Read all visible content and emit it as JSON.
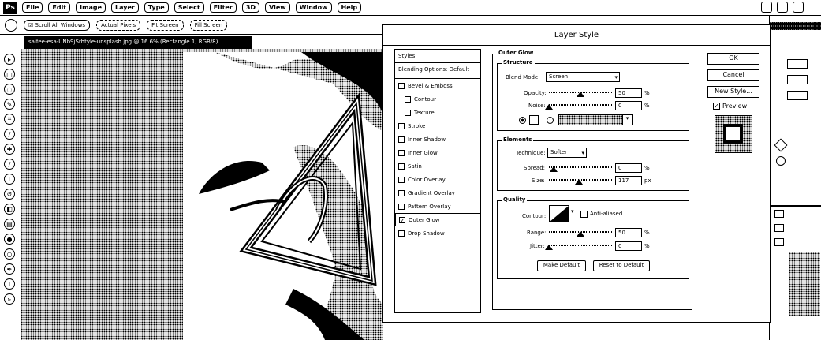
{
  "app": {
    "logo": "Ps",
    "menu": [
      "File",
      "Edit",
      "Image",
      "Layer",
      "Type",
      "Select",
      "Filter",
      "3D",
      "View",
      "Window",
      "Help"
    ]
  },
  "options_bar": {
    "scroll_all": "Scroll All Windows",
    "actual_pixels": "Actual Pixels",
    "fit_screen": "Fit Screen",
    "fill_screen": "Fill Screen"
  },
  "document": {
    "tab_title": "saifee-esa-UNb9jSrhtyle-unsplash.jpg @ 16.6% (Rectangle 1, RGB/8)"
  },
  "dialog": {
    "title": "Layer Style",
    "styles_header": "Styles",
    "blending_options": "Blending Options: Default",
    "style_items": [
      {
        "label": "Bevel & Emboss",
        "checked": false,
        "indent": false
      },
      {
        "label": "Contour",
        "checked": false,
        "indent": true
      },
      {
        "label": "Texture",
        "checked": false,
        "indent": true
      },
      {
        "label": "Stroke",
        "checked": false,
        "indent": false
      },
      {
        "label": "Inner Shadow",
        "checked": false,
        "indent": false
      },
      {
        "label": "Inner Glow",
        "checked": false,
        "indent": false
      },
      {
        "label": "Satin",
        "checked": false,
        "indent": false
      },
      {
        "label": "Color Overlay",
        "checked": false,
        "indent": false
      },
      {
        "label": "Gradient Overlay",
        "checked": false,
        "indent": false
      },
      {
        "label": "Pattern Overlay",
        "checked": false,
        "indent": false
      },
      {
        "label": "Outer Glow",
        "checked": true,
        "indent": false
      },
      {
        "label": "Drop Shadow",
        "checked": false,
        "indent": false
      }
    ],
    "outer_glow": {
      "section_title": "Outer Glow",
      "structure_title": "Structure",
      "blend_mode_label": "Blend Mode:",
      "blend_mode_value": "Screen",
      "opacity_label": "Opacity:",
      "opacity_value": "50",
      "opacity_unit": "%",
      "opacity_fraction": 0.5,
      "noise_label": "Noise:",
      "noise_value": "0",
      "noise_unit": "%",
      "noise_fraction": 0.0,
      "elements_title": "Elements",
      "technique_label": "Technique:",
      "technique_value": "Softer",
      "spread_label": "Spread:",
      "spread_value": "0",
      "spread_unit": "%",
      "size_label": "Size:",
      "size_value": "117",
      "size_unit": "px",
      "quality_title": "Quality",
      "contour_label": "Contour:",
      "anti_aliased_label": "Anti-aliased",
      "range_label": "Range:",
      "range_value": "50",
      "range_unit": "%",
      "range_fraction": 0.5,
      "jitter_label": "Jitter:",
      "jitter_value": "0",
      "jitter_unit": "%",
      "jitter_fraction": 0.0,
      "make_default": "Make Default",
      "reset_default": "Reset to Default"
    },
    "buttons": {
      "ok": "OK",
      "cancel": "Cancel",
      "new_style": "New Style...",
      "preview": "Preview",
      "preview_checked": true
    }
  }
}
